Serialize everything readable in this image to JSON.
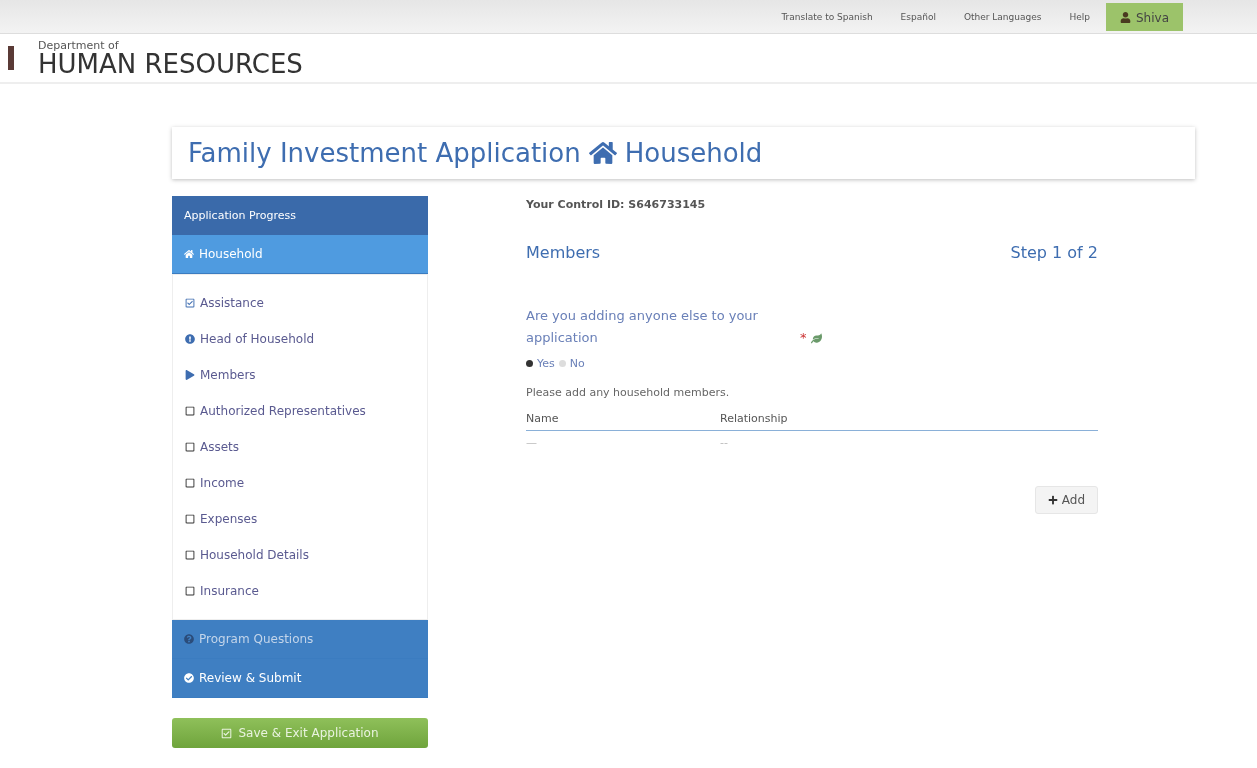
{
  "top_bar": {
    "links": [
      "Translate to Spanish",
      "Español",
      "Other Languages",
      "Help"
    ],
    "user": "Shiva"
  },
  "logo": {
    "small": "Department of",
    "large": "HUMAN RESOURCES"
  },
  "page_title": {
    "text": "Family Investment Application",
    "section": "Household"
  },
  "sidebar": {
    "title": "Application Progress",
    "items": [
      {
        "label": "Household",
        "kind": "section",
        "selected": true,
        "disabled": false
      },
      {
        "label": "Assistance",
        "kind": "done",
        "selected": false,
        "disabled": false
      },
      {
        "label": "Head of Household",
        "kind": "alert",
        "selected": false,
        "disabled": false
      },
      {
        "label": "Members",
        "kind": "current",
        "selected": false,
        "disabled": false
      },
      {
        "label": "Authorized Representatives",
        "kind": "todo",
        "selected": false,
        "disabled": false
      },
      {
        "label": "Assets",
        "kind": "todo",
        "selected": false,
        "disabled": false
      },
      {
        "label": "Income",
        "kind": "todo",
        "selected": false,
        "disabled": false
      },
      {
        "label": "Expenses",
        "kind": "todo",
        "selected": false,
        "disabled": false
      },
      {
        "label": "Household Details",
        "kind": "todo",
        "selected": false,
        "disabled": false
      },
      {
        "label": "Insurance",
        "kind": "todo",
        "selected": false,
        "disabled": false
      },
      {
        "label": "Program Questions",
        "kind": "question",
        "selected": false,
        "disabled": true
      },
      {
        "label": "Review & Submit",
        "kind": "review",
        "selected": false,
        "disabled": false
      }
    ],
    "save_button": "Save & Exit Application"
  },
  "content": {
    "control_id": "Your Control ID: S646733145",
    "heading": "Members",
    "step": "Step 1 of 2",
    "question": "Are you adding anyone else to your application",
    "required_mark": "*",
    "options": [
      {
        "label": "Yes",
        "selected": true
      },
      {
        "label": "No",
        "selected": false
      }
    ],
    "instruction": "Please add any household members.",
    "table": {
      "columns": [
        "Name",
        "Relationship"
      ],
      "rows": [
        [
          "—",
          "--"
        ]
      ]
    },
    "add_button": "Add"
  }
}
